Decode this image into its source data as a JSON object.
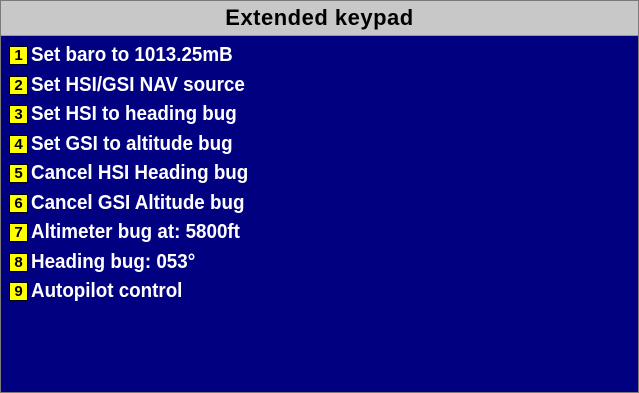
{
  "title": "Extended keypad",
  "colors": {
    "background": "#000080",
    "title_bar": "#c8c8c8",
    "key_background": "#ffff00",
    "text": "#ffffff"
  },
  "items": [
    {
      "key": "1",
      "label": "Set baro to 1013.25mB"
    },
    {
      "key": "2",
      "label": "Set HSI/GSI NAV source"
    },
    {
      "key": "3",
      "label": "Set HSI to heading bug"
    },
    {
      "key": "4",
      "label": "Set GSI to altitude bug"
    },
    {
      "key": "5",
      "label": "Cancel HSI Heading bug"
    },
    {
      "key": "6",
      "label": "Cancel GSI Altitude bug"
    },
    {
      "key": "7",
      "label": "Altimeter bug at: 5800ft"
    },
    {
      "key": "8",
      "label": "Heading bug: 053°"
    },
    {
      "key": "9",
      "label": "Autopilot control"
    }
  ]
}
